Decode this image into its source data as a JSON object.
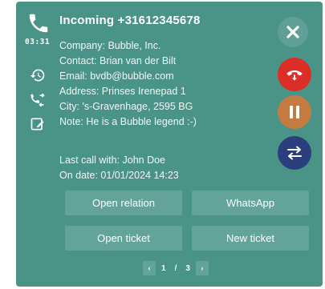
{
  "call": {
    "timer": "03:31",
    "title": "Incoming +31612345678"
  },
  "contact": {
    "company": "Company: Bubble, Inc.",
    "contact": "Contact: Brian van der Bilt",
    "email": "Email: bvdb@bubble.com",
    "address": "Address: Prinses Irenepad 1",
    "city": "City: 's-Gravenhage, 2595 BG",
    "note": "Note: He is a Bubble legend :-)"
  },
  "history": {
    "last_call": "Last call with: John Doe",
    "on_date": "On date: 01/01/2024 14:23"
  },
  "actions": {
    "open_relation": "Open relation",
    "whatsapp": "WhatsApp",
    "open_ticket": "Open ticket",
    "new_ticket": "New ticket"
  },
  "pager": {
    "prev": "‹",
    "current": "1",
    "separator": "/",
    "total": "3",
    "next": "›"
  },
  "icons": {
    "call": "phone-icon",
    "history": "history-icon",
    "transfer": "call-transfer-icon",
    "note": "note-icon",
    "close": "close-icon",
    "hangup": "hangup-icon",
    "hold": "pause-icon",
    "swap": "swap-icon"
  },
  "colors": {
    "panel": "#4a9387",
    "button": "#64a398",
    "hangup": "#dd2d27",
    "hold": "#c57b3f",
    "transfer": "#2b3f7d"
  }
}
